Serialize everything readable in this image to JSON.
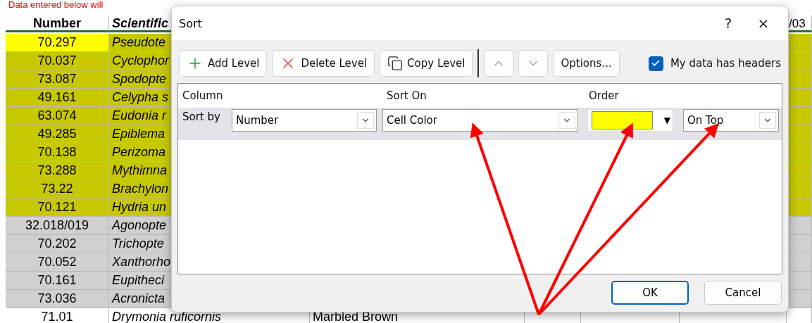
{
  "banner": "Data entered below will",
  "sheet": {
    "columns": [
      "Number",
      "Scientific",
      "/03"
    ],
    "rows": [
      {
        "number": "70.297",
        "name": "Pseudote",
        "color": "#c8c800",
        "highlighted": true
      },
      {
        "number": "70.037",
        "name": "Cyclophor",
        "color": "#c8c800",
        "highlighted": false
      },
      {
        "number": "73.087",
        "name": "Spodopte",
        "color": "#c8c800",
        "highlighted": false
      },
      {
        "number": "49.161",
        "name": "Celypha s",
        "color": "#c8c800",
        "highlighted": false
      },
      {
        "number": "63.074",
        "name": "Eudonia r",
        "color": "#c8c800",
        "highlighted": false
      },
      {
        "number": "49.285",
        "name": "Epiblema",
        "color": "#c8c800",
        "highlighted": false
      },
      {
        "number": "70.138",
        "name": "Perizoma",
        "color": "#c8c800",
        "highlighted": false
      },
      {
        "number": "73.288",
        "name": "Mythimna",
        "color": "#c8c800",
        "highlighted": false
      },
      {
        "number": "73.22",
        "name": "Brachylon",
        "color": "#c8c800",
        "highlighted": false
      },
      {
        "number": "70.121",
        "name": "Hydria un",
        "color": "#c8c800",
        "highlighted": false
      },
      {
        "number": "32.018/019",
        "name": "Agonopte",
        "color": "#d0d0d0",
        "highlighted": false
      },
      {
        "number": "70.202",
        "name": "Trichopte",
        "color": "#d0d0d0",
        "highlighted": false
      },
      {
        "number": "70.052",
        "name": "Xanthorho",
        "color": "#d0d0d0",
        "highlighted": false
      },
      {
        "number": "70.161",
        "name": "Eupitheci",
        "color": "#d0d0d0",
        "highlighted": false
      },
      {
        "number": "73.036",
        "name": "Acronicta",
        "color": "#d0d0d0",
        "highlighted": false
      },
      {
        "number": "71.01",
        "name": "Drymonia ruficornis",
        "common": "Marbled Brown",
        "color": "#ffffff",
        "highlighted": false
      }
    ]
  },
  "dialog": {
    "title": "Sort",
    "help": "?",
    "close": "×",
    "toolbar": [
      {
        "kind": "add",
        "label": "Add Level"
      },
      {
        "kind": "delete",
        "label": "Delete Level"
      },
      {
        "kind": "copy",
        "label": "Copy Level"
      },
      {
        "kind": "separator"
      },
      {
        "kind": "up"
      },
      {
        "kind": "down"
      },
      {
        "kind": "text",
        "label": "Options..."
      }
    ],
    "headers_checkbox": {
      "label": "My data has headers",
      "checked": true
    },
    "columns": [
      "Column",
      "Sort On",
      "Order"
    ],
    "levels": [
      {
        "label": "Sort by",
        "column": "Number",
        "sort_on": "Cell Color",
        "color": "#ffff00",
        "color_arrow": "▼",
        "order": "On Top",
        "selected": true
      }
    ],
    "buttons": [
      {
        "label": "OK",
        "default": true
      },
      {
        "label": "Cancel",
        "default": false
      }
    ]
  }
}
